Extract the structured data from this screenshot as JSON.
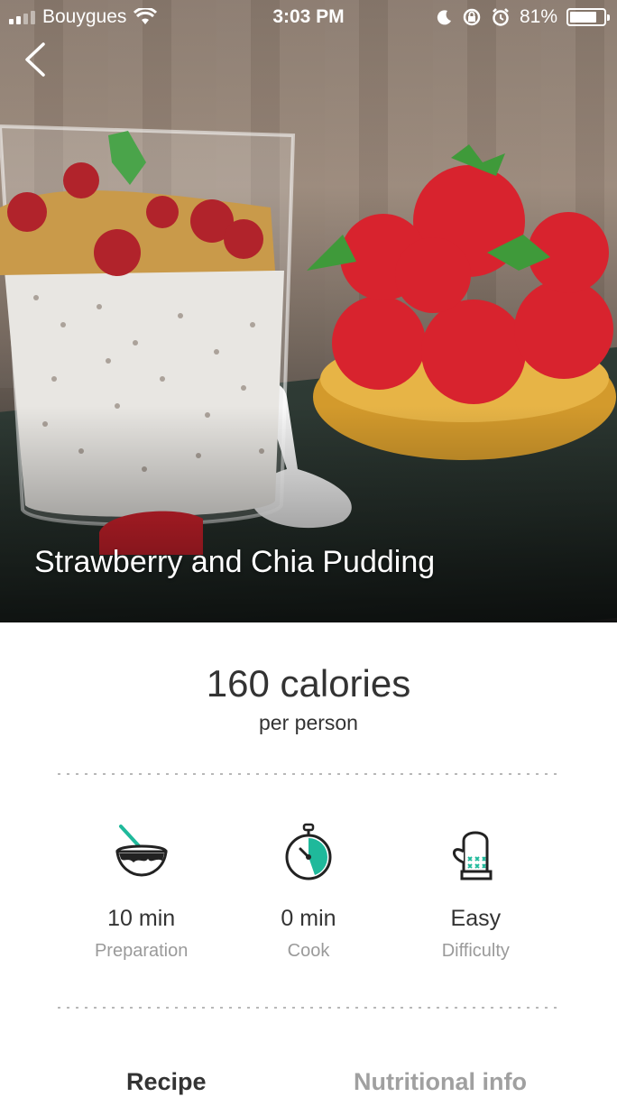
{
  "status_bar": {
    "carrier": "Bouygues",
    "time": "3:03 PM",
    "battery_percent": "81%",
    "battery_level": 0.81,
    "signal_bars": 2,
    "icons": [
      "wifi-icon",
      "moon-icon",
      "rotation-lock-icon",
      "alarm-icon",
      "battery-icon"
    ]
  },
  "header": {
    "back_icon": "chevron-left-icon"
  },
  "recipe": {
    "title": "Strawberry and Chia Pudding",
    "calories": "160 calories",
    "per_person": "per person"
  },
  "stats": [
    {
      "icon": "mixing-bowl-icon",
      "value": "10 min",
      "label": "Preparation"
    },
    {
      "icon": "stopwatch-icon",
      "value": "0 min",
      "label": "Cook"
    },
    {
      "icon": "oven-mitt-icon",
      "value": "Easy",
      "label": "Difficulty"
    }
  ],
  "tabs": [
    {
      "label": "Recipe",
      "active": true
    },
    {
      "label": "Nutritional info",
      "active": false
    }
  ],
  "colors": {
    "accent": "#1fb99b",
    "text": "#333333",
    "muted": "#9a9a9a"
  }
}
